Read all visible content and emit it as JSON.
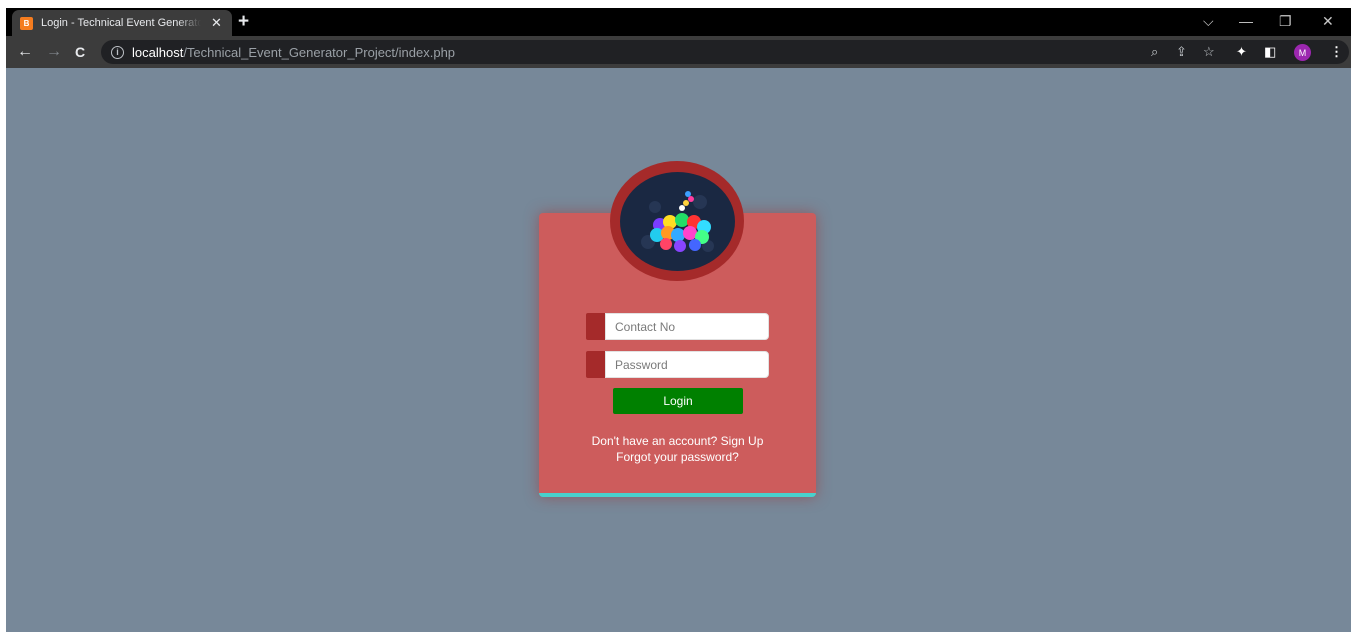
{
  "browser": {
    "tab": {
      "title": "Login - Technical Event Generator Project",
      "favicon_text": "B",
      "close_glyph": "✕"
    },
    "new_tab_glyph": "+",
    "window_controls": {
      "tab_search": "⌵",
      "minimize": "—",
      "restore": "❐",
      "close": "✕"
    },
    "nav": {
      "back": "←",
      "forward": "→",
      "reload": "C"
    },
    "address": {
      "info_glyph": "i",
      "host": "localhost",
      "path": "/Technical_Event_Generator_Project/index.php"
    },
    "toolbar_icons": {
      "zoom": "⌕",
      "share": "⇪",
      "bookmark": "☆",
      "extensions": "✦",
      "side_panel": "◧",
      "menu": "⋮"
    },
    "profile_initial": "M"
  },
  "page": {
    "background_color": "#778899",
    "card_color": "#cd5c5c",
    "accent_color": "#a52a2a",
    "button_color": "#008000",
    "border_accent": "#48d1cc",
    "form": {
      "contact_placeholder": "Contact No",
      "password_placeholder": "Password",
      "login_label": "Login"
    },
    "links": {
      "signup_prompt": "Don't have an account?  Sign Up",
      "forgot_password": "Forgot your password?"
    }
  },
  "icons": {
    "logo": "event-logo-icon"
  }
}
